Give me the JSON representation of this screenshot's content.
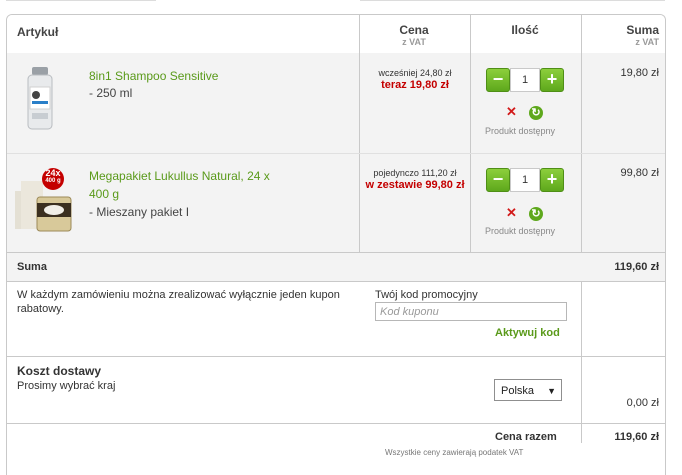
{
  "header": {
    "col_article": "Artykuł",
    "col_price": "Cena",
    "col_price_sub": "z VAT",
    "col_qty": "Ilość",
    "col_sum": "Suma",
    "col_sum_sub": "z VAT"
  },
  "items": [
    {
      "name": "8in1 Shampoo Sensitive",
      "variant": "- 250 ml",
      "old_price": "wcześniej 24,80 zł",
      "new_price": "teraz 19,80 zł",
      "quantity": "1",
      "availability": "Produkt dostępny",
      "sum": "19,80 zł",
      "image_icon": "shampoo-bottle"
    },
    {
      "name": "Megapakiet Lukullus Natural, 24 x 400 g",
      "name_line1": "Megapakiet Lukullus Natural, 24 x",
      "name_line2": "400 g",
      "variant": "- Mieszany pakiet I",
      "old_price": "pojedynczo 111,20 zł",
      "new_price": "w zestawie 99,80 zł",
      "quantity": "1",
      "availability": "Produkt dostępny",
      "sum": "99,80 zł",
      "image_icon": "can-pack",
      "badge_top": "24x",
      "badge_bottom": "400 g"
    }
  ],
  "subtotal": {
    "label": "Suma",
    "value": "119,60 zł"
  },
  "coupon": {
    "note": "W każdym zamówieniu można zrealizować wyłącznie jeden kupon rabatowy.",
    "label": "Twój kod promocyjny",
    "placeholder": "Kod kuponu",
    "activate": "Aktywuj kod"
  },
  "shipping": {
    "title": "Koszt dostawy",
    "note": "Prosimy wybrać kraj",
    "country": "Polska",
    "value": "0,00 zł"
  },
  "total": {
    "label": "Cena razem",
    "value": "119,60 zł",
    "vat_note": "Wszystkie ceny zawierają podatek VAT"
  },
  "colors": {
    "accent_green": "#5a9a1a",
    "price_red": "#c40000",
    "row_bg": "#f3f3f3",
    "border": "#c9c9c9"
  }
}
